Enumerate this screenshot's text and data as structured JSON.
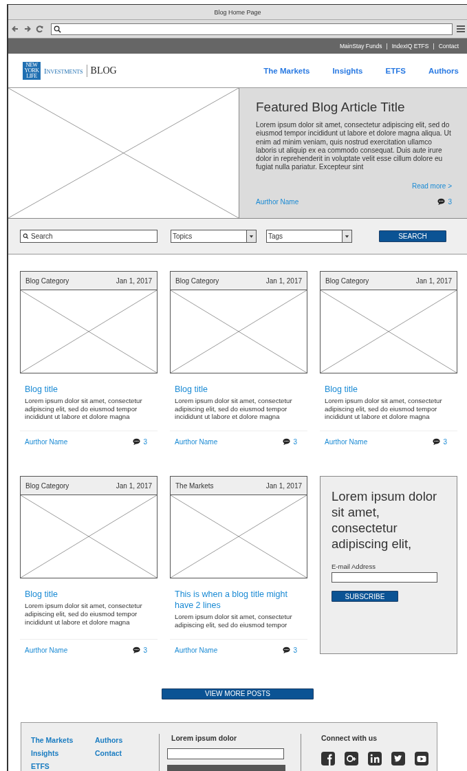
{
  "window": {
    "title": "Blog Home Page"
  },
  "utility_links": [
    "MainStay Funds",
    "IndexIQ ETFS",
    "Contact"
  ],
  "utility_separator": "|",
  "logo": {
    "mark_lines": [
      "NEW",
      "YORK",
      "LIFE"
    ],
    "wordmark": "Investments",
    "product": "BLOG"
  },
  "nav": [
    "The Markets",
    "Insights",
    "ETFS",
    "Authors"
  ],
  "featured": {
    "title": "Featured Blog Article Title",
    "excerpt": "Lorem ipsum dolor sit amet, consectetur adipiscing elit, sed do eiusmod tempor incididunt ut labore et dolore magna aliqua. Ut enim ad minim veniam, quis nostrud exercitation ullamco laboris ut aliquip ex ea commodo consequat. Duis aute irure dolor in reprehenderit in voluptate velit esse cillum dolore eu fugiat nulla pariatur. Excepteur sint",
    "read_more": "Read more >",
    "author": "Aurthor Name",
    "comments": "3"
  },
  "filters": {
    "search_placeholder": "Search",
    "topics": "Topics",
    "tags": "Tags",
    "button": "SEARCH"
  },
  "posts": [
    {
      "category": "Blog Category",
      "date": "Jan 1, 2017",
      "title": "Blog title",
      "excerpt": "Lorem ipsum dolor sit amet, consectetur adipiscing elit, sed do eiusmod tempor incididunt ut labore et dolore magna",
      "author": "Aurthor Name",
      "comments": "3"
    },
    {
      "category": "Blog Category",
      "date": "Jan 1, 2017",
      "title": "Blog title",
      "excerpt": "Lorem ipsum dolor sit amet, consectetur adipiscing elit, sed do eiusmod tempor incididunt ut labore et dolore magna",
      "author": "Aurthor Name",
      "comments": "3"
    },
    {
      "category": "Blog Category",
      "date": "Jan 1, 2017",
      "title": "Blog title",
      "excerpt": "Lorem ipsum dolor sit amet, consectetur adipiscing elit, sed do eiusmod tempor incididunt ut labore et dolore magna",
      "author": "Aurthor Name",
      "comments": "3"
    },
    {
      "category": "Blog Category",
      "date": "Jan 1, 2017",
      "title": "Blog title",
      "excerpt": "Lorem ipsum dolor sit amet, consectetur adipiscing elit, sed do eiusmod tempor incididunt ut labore et dolore magna",
      "author": "Aurthor Name",
      "comments": "3"
    },
    {
      "category": "The Markets",
      "date": "Jan 1, 2017",
      "title": "This is when a blog title might have 2 lines",
      "excerpt": "Lorem ipsum dolor sit amet, consectetur adipiscing elit, sed do eiusmod tempor",
      "author": "Aurthor Name",
      "comments": "3"
    }
  ],
  "subscribe": {
    "heading": "Lorem ipsum dolor sit amet, consectetur adipiscing elit,",
    "label": "E-mail Address",
    "button": "SUBSCRIBE"
  },
  "view_more": "VIEW MORE POSTS",
  "footer": {
    "links_1": [
      "The Markets",
      "Insights",
      "ETFS"
    ],
    "links_2": [
      "Authors",
      "Contact"
    ],
    "signup_heading": "Lorem ipsum dolor",
    "social_heading": "Connect with us",
    "social": [
      {
        "kind": "facebook"
      },
      {
        "kind": "googleplus"
      },
      {
        "kind": "linkedin"
      },
      {
        "kind": "twitter"
      },
      {
        "kind": "youtube"
      }
    ]
  }
}
